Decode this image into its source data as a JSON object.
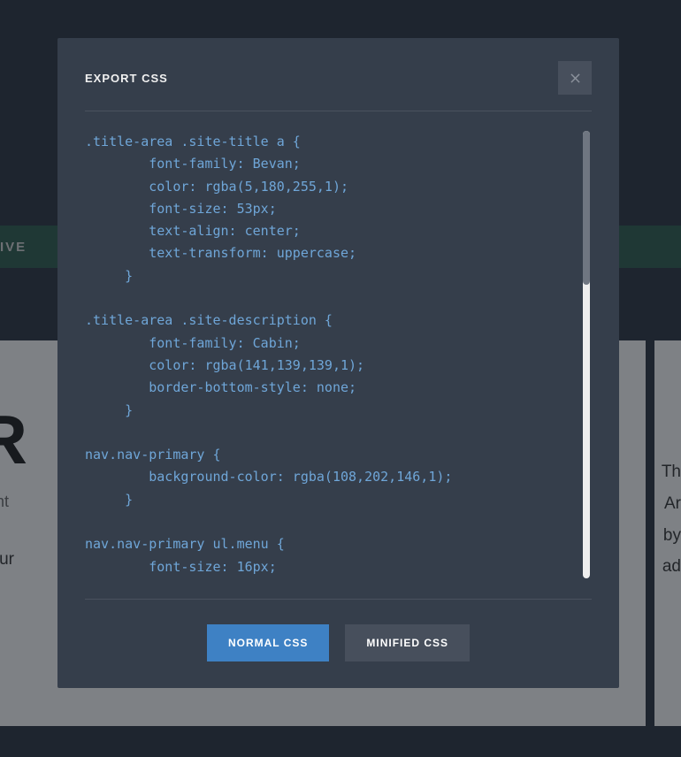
{
  "modal": {
    "title": "EXPORT CSS",
    "buttons": {
      "normal": "NORMAL CSS",
      "minified": "MINIFIED CSS"
    },
    "code": ".title-area .site-title a {\n        font-family: Bevan;\n        color: rgba(5,180,255,1);\n        font-size: 53px;\n        text-align: center;\n        text-transform: uppercase;\n     }\n\n.title-area .site-description {\n        font-family: Cabin;\n        color: rgba(141,139,139,1);\n        border-bottom-style: none;\n     }\n\nnav.nav-primary {\n        background-color: rgba(108,202,146,1);\n     }\n\nnav.nav-primary ul.menu {\n        font-size: 16px;"
  },
  "background": {
    "nav_item": "IVE",
    "heading": "OR",
    "meta_comment": "nment",
    "body_text": "is your",
    "right_line_1": "Th",
    "right_line_2": "Ar",
    "right_line_3": "by",
    "right_line_4": "ad"
  }
}
